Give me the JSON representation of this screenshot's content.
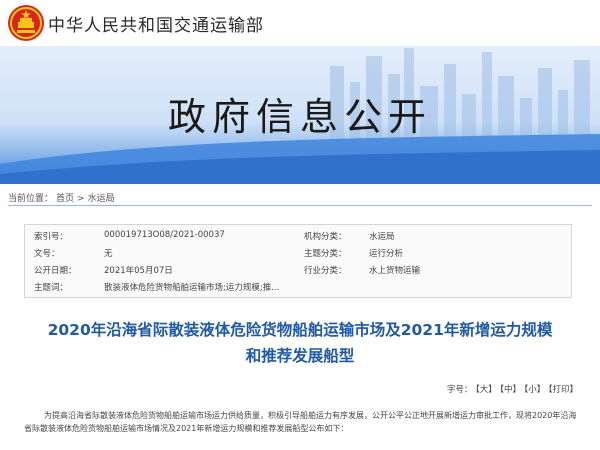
{
  "header": {
    "site_name": "中华人民共和国交通运输部"
  },
  "banner": {
    "title": "政府信息公开"
  },
  "breadcrumb": {
    "label": "当前位置：",
    "home": "首页",
    "sep": ">",
    "section": "水运局"
  },
  "info": {
    "rows": [
      {
        "k1": "索引号：",
        "v1": "000019713O08/2021-00037",
        "k2": "机构分类：",
        "v2": "水运局"
      },
      {
        "k1": "文号：",
        "v1": "无",
        "k2": "主题分类：",
        "v2": "运行分析"
      },
      {
        "k1": "公开日期：",
        "v1": "2021年05月07日",
        "k2": "行业分类：",
        "v2": "水上货物运输"
      },
      {
        "k1": "主题词：",
        "v1": "散装液体危险货物船舶运输市场;运力规模;推...",
        "k2": "",
        "v2": ""
      }
    ]
  },
  "article": {
    "title": "2020年沿海省际散装液体危险货物船舶运输市场及2021年新增运力规模和推荐发展船型"
  },
  "font_size": {
    "label": "字号：",
    "large": "【大】",
    "medium": "【中】",
    "small": "【小】",
    "print": "【打印】"
  },
  "body": {
    "line1": "为提高沿海省际散装液体危险货物船舶运输市场运力供给质量，积极引导船舶运力有序发展，公开公平公正地开展新增运力审批工作，现将2020年沿海省际散装液体危险货物船舶运输市场情况及2021年新增运力规模和推荐发展船型公布如下："
  }
}
